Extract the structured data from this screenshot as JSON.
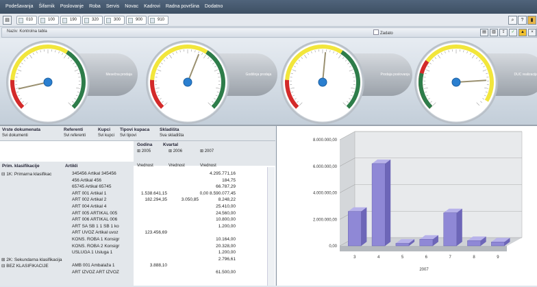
{
  "menu": [
    "Podešavanja",
    "Šifarnik",
    "Poslovanje",
    "Roba",
    "Servis",
    "Novac",
    "Kadrovi",
    "Radna površina",
    "Dodatno"
  ],
  "toolbar": {
    "buttons": [
      "010",
      "100",
      "190",
      "320",
      "300",
      "900",
      "910"
    ]
  },
  "window": {
    "title": "Naziv: Kontrolna tabla",
    "checkbox_label": "Zadato"
  },
  "gauges": [
    {
      "label": "Mesečna prodaja",
      "value": 0.12
    },
    {
      "label": "Godišnja prodaja",
      "value": 0.58
    },
    {
      "label": "Prodaja poslovanja",
      "value": 0.52
    },
    {
      "label": "DUC realizacija",
      "value": 0.82
    }
  ],
  "pivot": {
    "filters": [
      {
        "name": "Vrste dokumenata",
        "value": "Svi dokumenti"
      },
      {
        "name": "Referenti",
        "value": "Svi referenti"
      },
      {
        "name": "Kupci",
        "value": "Svi kupci"
      },
      {
        "name": "Tipovi kupaca",
        "value": "Svi tipovi"
      },
      {
        "name": "Skladišta",
        "value": "Sva skladišta"
      }
    ],
    "col_fields": [
      "Godina",
      "Kvartal"
    ],
    "years": [
      "⊞ 2005",
      "⊞ 2006",
      "⊞ 2007"
    ],
    "measure": "Vrednost",
    "row_fields": [
      "Prim. klasifikacije",
      "Artikli"
    ],
    "rows": [
      {
        "group": "⊟ 1K: Primarna klasifikac",
        "item": "345456 Artikal 345456",
        "v1": "",
        "v2": "",
        "v3": "4.295.771,16"
      },
      {
        "group": "",
        "item": "456 Artikal 456",
        "v1": "",
        "v2": "",
        "v3": "184,75"
      },
      {
        "group": "",
        "item": "65745 Artikal 65745",
        "v1": "",
        "v2": "",
        "v3": "66.787,29"
      },
      {
        "group": "",
        "item": "ART 001 Artikal 1",
        "v1": "1.538.641,15",
        "v2": "",
        "v3": "0,00 8.590.077,45"
      },
      {
        "group": "",
        "item": "ART 002 Artikal 2",
        "v1": "182.294,35",
        "v2": "3.050,85",
        "v3": "8.248,22"
      },
      {
        "group": "",
        "item": "ART 004 Artikal 4",
        "v1": "",
        "v2": "",
        "v3": "25.410,00"
      },
      {
        "group": "",
        "item": "ART 005 ARTIKAL 005",
        "v1": "",
        "v2": "",
        "v3": "24.560,00"
      },
      {
        "group": "",
        "item": "ART 006 ARTIKAL 006",
        "v1": "",
        "v2": "",
        "v3": "10.800,00"
      },
      {
        "group": "",
        "item": "ART SA SB 1 1 SB 1 ko",
        "v1": "",
        "v2": "",
        "v3": "1.200,00"
      },
      {
        "group": "",
        "item": "ART UVOZ Artikal uvoz",
        "v1": "123.456,69",
        "v2": "",
        "v3": ""
      },
      {
        "group": "",
        "item": "KONS. ROBA 1 Konsigr",
        "v1": "",
        "v2": "",
        "v3": "10.164,00"
      },
      {
        "group": "",
        "item": "KONS. ROBA 2 Konsigr",
        "v1": "",
        "v2": "",
        "v3": "20.328,00"
      },
      {
        "group": "",
        "item": "USLUGA 1 Usluga 1",
        "v1": "",
        "v2": "",
        "v3": "1.200,00"
      },
      {
        "group": "⊞ 2K: Sekundarna klasifikacija",
        "item": "",
        "v1": "",
        "v2": "",
        "v3": "2.796,61"
      },
      {
        "group": "⊟ BEZ KLASIFIKACIJE",
        "item": "AMB 001 Ambalaža 1",
        "v1": "3.888,10",
        "v2": "",
        "v3": ""
      },
      {
        "group": "",
        "item": "ART IZVOZ ART IZVOZ",
        "v1": "",
        "v2": "",
        "v3": "61.500,00"
      }
    ]
  },
  "chart_data": {
    "type": "bar",
    "categories": [
      "3",
      "4",
      "5",
      "6",
      "7",
      "8",
      "9"
    ],
    "values": [
      2600000,
      6200000,
      200000,
      500000,
      2500000,
      400000,
      300000
    ],
    "xlabel": "2007",
    "ylim": [
      0,
      8000000
    ],
    "yticks": [
      "0,00",
      "2.000.000,00",
      "4.000.000,00",
      "6.000.000,00",
      "8.000.000,00"
    ],
    "bar_color": "#8f88d6",
    "grid": true
  }
}
